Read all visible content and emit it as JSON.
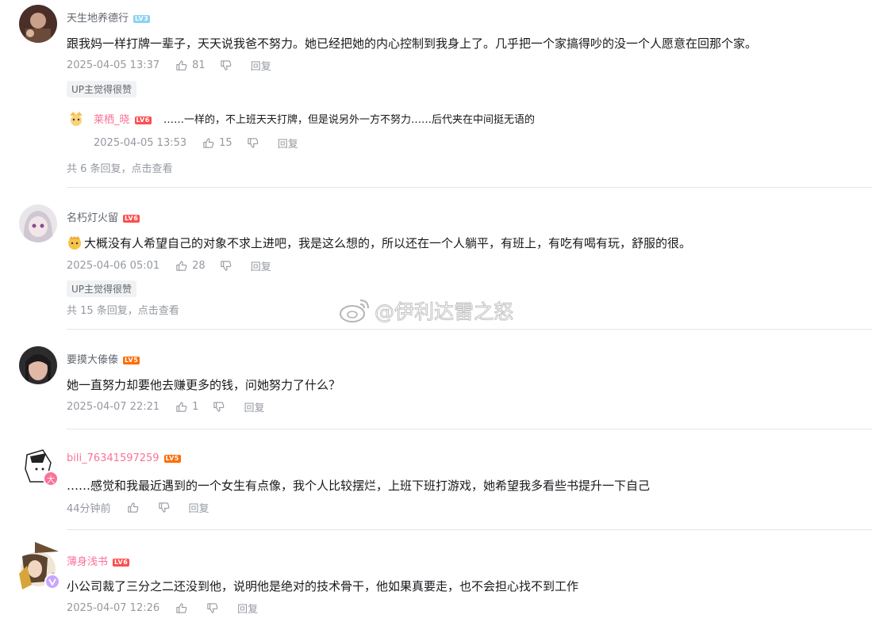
{
  "comments": [
    {
      "username": "天生地养德行",
      "level": "LV3",
      "text": "跟我妈一样打牌一辈子，天天说我爸不努力。她已经把她的内心控制到我身上了。几乎把一个家搞得吵的没一个人愿意在回那个家。",
      "time": "2025-04-05 13:37",
      "likes": "81",
      "reply_label": "回复",
      "tag": "UP主觉得很赞",
      "sub_reply": {
        "username": "莱栖_晓",
        "level": "LV6",
        "text": "……一样的，不上班天天打牌，但是说另外一方不努力……后代夹在中间挺无语的",
        "time": "2025-04-05 13:53",
        "likes": "15",
        "reply_label": "回复"
      },
      "view_more": "共 6 条回复，点击查看"
    },
    {
      "username": "名朽灯火留",
      "level": "LV6",
      "text": "大概没有人希望自己的对象不求上进吧，我是这么想的，所以还在一个人躺平，有班上，有吃有喝有玩，舒服的很。",
      "time": "2025-04-06 05:01",
      "likes": "28",
      "reply_label": "回复",
      "tag": "UP主觉得很赞",
      "view_more": "共 15 条回复，点击查看"
    },
    {
      "username": "要摸大傣傣",
      "level": "LV5",
      "text": "她一直努力却要他去赚更多的钱，问她努力了什么？",
      "time": "2025-04-07 22:21",
      "likes": "1",
      "reply_label": "回复"
    },
    {
      "username": "bili_76341597259",
      "level": "LV5",
      "text": "……感觉和我最近遇到的一个女生有点像，我个人比较摆烂，上班下班打游戏，她希望我多看些书提升一下自己",
      "time": "44分钟前",
      "likes": "",
      "reply_label": "回复"
    },
    {
      "username": "薄身浅书",
      "level": "LV6",
      "text": "小公司裁了三分之二还没到他，说明他是绝对的技术骨干，他如果真要走，也不会担心找不到工作",
      "time": "2025-04-07 12:26",
      "likes": "",
      "reply_label": "回复"
    }
  ],
  "watermark": "@伊利达雷之怒",
  "badges": {
    "big_member": "大"
  },
  "icons": {
    "like": "thumbs-up-icon",
    "dislike": "thumbs-down-icon",
    "watermark": "weibo-logo-icon"
  },
  "colors": {
    "pink_username": "#fb7299",
    "meta_gray": "#9499a0",
    "level_orange": "#ff6c00",
    "level_blue": "#8bd1f3",
    "level_red": "#fc4f4f"
  }
}
